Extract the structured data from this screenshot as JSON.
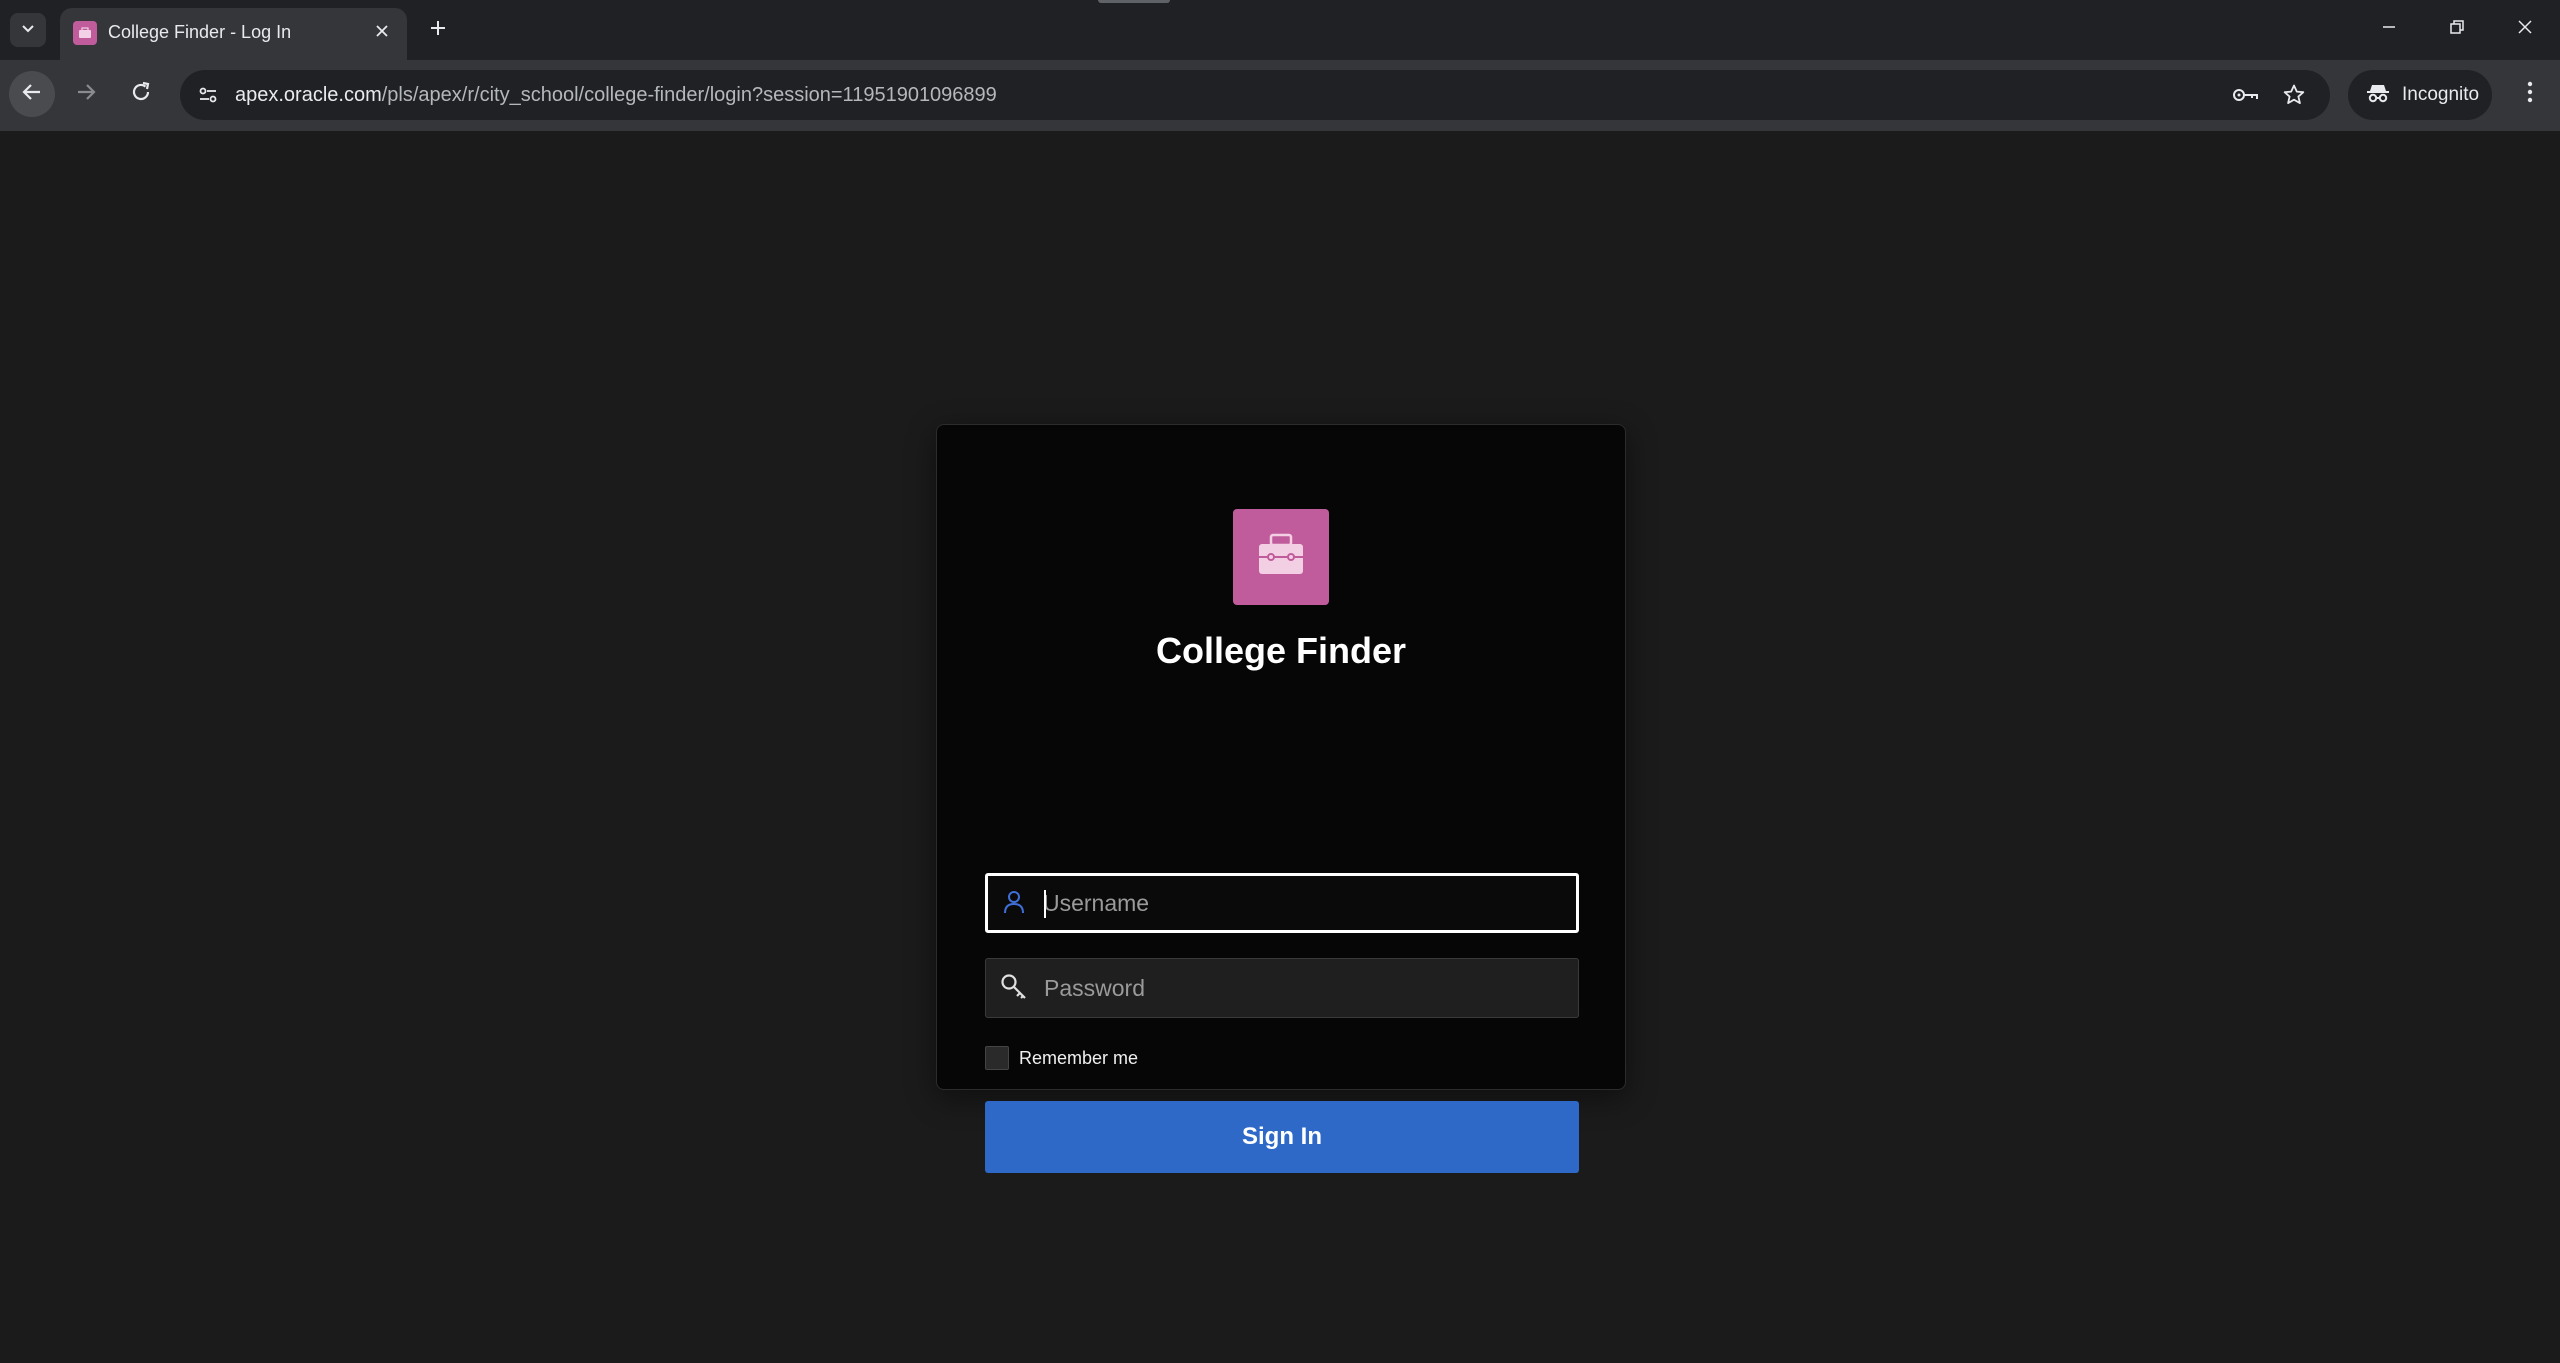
{
  "browser": {
    "tab": {
      "title": "College Finder - Log In",
      "favicon_color": "#c05c9c"
    },
    "address_bar": {
      "host": "apex.oracle.com",
      "path": "/pls/apex/r/city_school/college-finder/login?session=11951901096899"
    },
    "incognito_label": "Incognito"
  },
  "login": {
    "app_title": "College Finder",
    "logo_icon": "briefcase-icon",
    "logo_color": "#c05c9c",
    "username": {
      "placeholder": "Username",
      "value": ""
    },
    "password": {
      "placeholder": "Password",
      "value": ""
    },
    "remember_me_label": "Remember me",
    "remember_me_checked": false,
    "sign_in_label": "Sign In",
    "sign_in_color": "#2e69c8"
  }
}
